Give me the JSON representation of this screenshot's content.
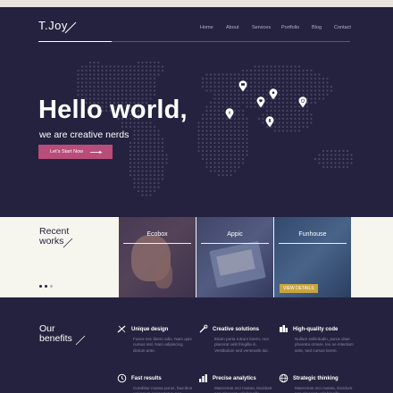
{
  "brand": {
    "logo": "T.Joy"
  },
  "nav": {
    "items": [
      "Home",
      "About",
      "Services",
      "Portfolio",
      "Blog",
      "Contact"
    ]
  },
  "hero": {
    "title": "Hello world,",
    "subtitle": "we are creative nerds",
    "cta_label": "Let's Start Now"
  },
  "works": {
    "title_line1": "Recent",
    "title_line2": "works",
    "tiles": [
      {
        "label": "Ecobox"
      },
      {
        "label": "Appic"
      },
      {
        "label": "Funhouse",
        "button": "VIEW DETAILS"
      }
    ]
  },
  "benefits": {
    "title_line1": "Our",
    "title_line2": "benefits",
    "items": [
      {
        "icon": "scissors-ruler-icon",
        "title": "Unique design",
        "text": "Fusce nec libero odio. Nam quis cursus nisl. Nam adipiscing dictum ante."
      },
      {
        "icon": "tools-icon",
        "title": "Creative solutions",
        "text": "Etiam porta rutrum lorem, non placerat velit fringilla in. Vestibulum sed venenatis dui."
      },
      {
        "icon": "code-icon",
        "title": "High-quality code",
        "text": "Nullam sollicitudin, purus vitae pharetra ornare, leo ne interdum ante, sed cursus lorem."
      },
      {
        "icon": "clock-icon",
        "title": "Fast results",
        "text": "Curabitur massa purus, faucibus vel ipsum consectetur, nec volutpat."
      },
      {
        "icon": "chart-icon",
        "title": "Precise analytics",
        "text": "Maecenas orci massa, tincidunt non placerat velit fringilla."
      },
      {
        "icon": "globe-icon",
        "title": "Strategic thinking",
        "text": "Maecenas orci massa, tincidunt non placerat velit fringilla."
      }
    ]
  },
  "colors": {
    "navy": "#25223f",
    "cream": "#f6f5ee",
    "accent": "#b74d78"
  }
}
